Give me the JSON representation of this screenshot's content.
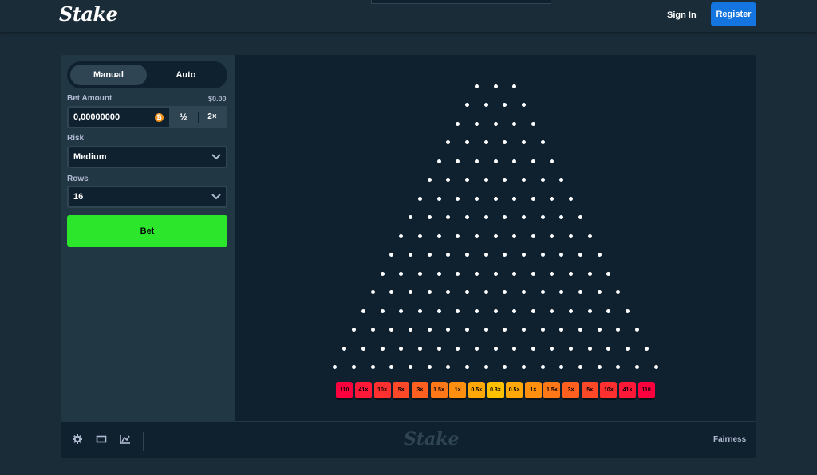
{
  "header": {
    "logo": "Stake",
    "sign_in": "Sign In",
    "register": "Register"
  },
  "controls": {
    "tabs": [
      {
        "label": "Manual",
        "active": true
      },
      {
        "label": "Auto",
        "active": false
      }
    ],
    "bet_amount": {
      "label": "Bet Amount",
      "usd": "$0.00",
      "value": "0,00000000",
      "currency_icon": "bitcoin-icon",
      "half": "½",
      "double": "2×"
    },
    "risk": {
      "label": "Risk",
      "value": "Medium"
    },
    "rows": {
      "label": "Rows",
      "value": "16"
    },
    "bet_button": "Bet"
  },
  "board": {
    "rows": 16,
    "multipliers": [
      "110",
      "41×",
      "10×",
      "5×",
      "3×",
      "1.5×",
      "1×",
      "0.5×",
      "0.3×",
      "0.5×",
      "1×",
      "1.5×",
      "3×",
      "5×",
      "10×",
      "41×",
      "110"
    ],
    "bucket_colors": [
      "#ff003f",
      "#ff1837",
      "#ff302f",
      "#ff4827",
      "#ff601f",
      "#ff7817",
      "#ff900f",
      "#ffa807",
      "#ffc000",
      "#ffa807",
      "#ff900f",
      "#ff7817",
      "#ff601f",
      "#ff4827",
      "#ff302f",
      "#ff1837",
      "#ff003f"
    ]
  },
  "footer": {
    "icons": [
      "settings-icon",
      "theatre-mode-icon",
      "stats-icon"
    ],
    "watermark": "Stake",
    "fairness": "Fairness"
  },
  "colors": {
    "accent_green": "#2ce62c",
    "accent_blue": "#1475e1",
    "panel": "#213743",
    "dark": "#0f212e",
    "background": "#1a2c38"
  }
}
